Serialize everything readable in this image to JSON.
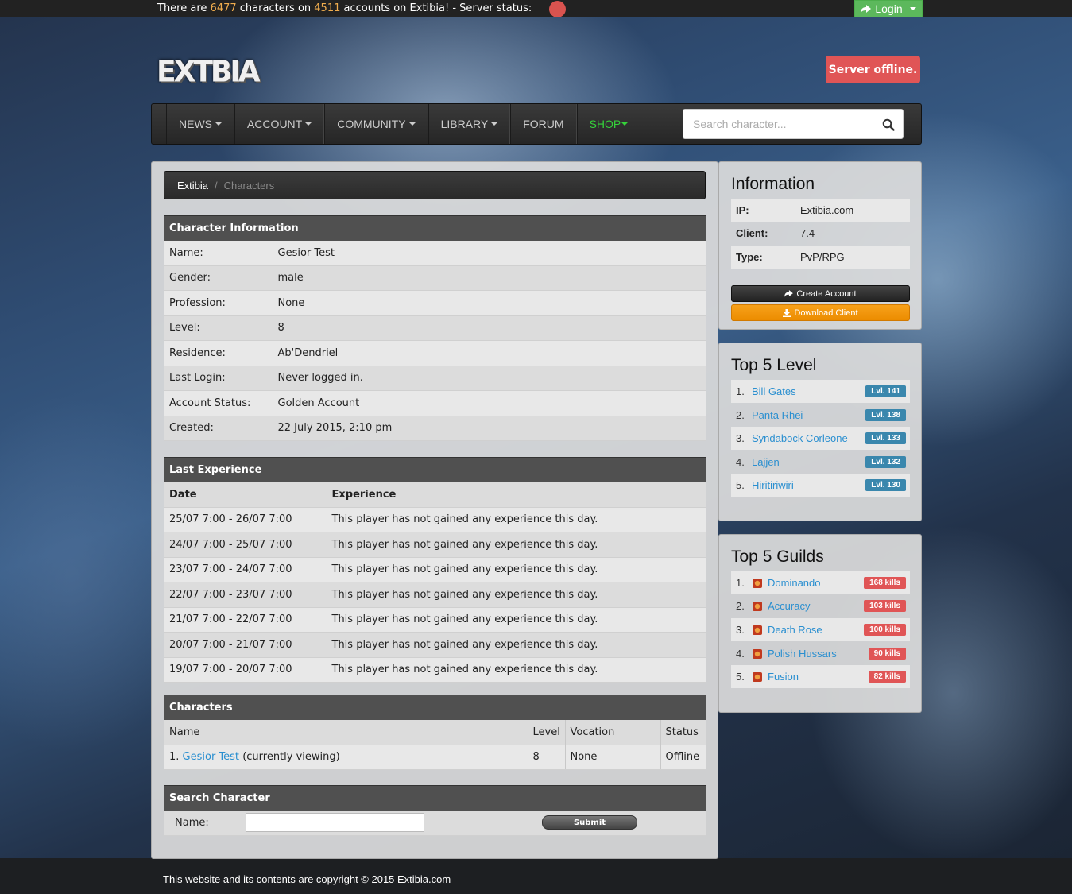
{
  "topbar": {
    "text_before": "There are",
    "characters_count": "6477",
    "text_mid1": "characters on",
    "accounts_count": "4511",
    "text_after": "accounts on Extibia! - Server status:",
    "login_label": "Login"
  },
  "logo_text": "EXTBIA",
  "server_status_label": "Server offline.",
  "nav": {
    "items": [
      {
        "label": "NEWS",
        "dropdown": true
      },
      {
        "label": "ACCOUNT",
        "dropdown": true
      },
      {
        "label": "COMMUNITY",
        "dropdown": true
      },
      {
        "label": "LIBRARY",
        "dropdown": true
      },
      {
        "label": "FORUM",
        "dropdown": false
      },
      {
        "label": "SHOP",
        "dropdown": true
      }
    ],
    "search_placeholder": "Search character..."
  },
  "breadcrumb": {
    "root": "Extibia",
    "sep": "/",
    "current": "Characters"
  },
  "character_info": {
    "title": "Character Information",
    "rows": [
      {
        "label": "Name:",
        "value": "Gesior Test"
      },
      {
        "label": "Gender:",
        "value": "male"
      },
      {
        "label": "Profession:",
        "value": "None"
      },
      {
        "label": "Level:",
        "value": "8"
      },
      {
        "label": "Residence:",
        "value": "Ab'Dendriel"
      },
      {
        "label": "Last Login:",
        "value": "Never logged in."
      },
      {
        "label": "Account Status:",
        "value": "Golden Account"
      },
      {
        "label": "Created:",
        "value": "22 July 2015, 2:10 pm"
      }
    ]
  },
  "last_experience": {
    "title": "Last Experience",
    "col_date": "Date",
    "col_exp": "Experience",
    "rows": [
      {
        "date": "25/07 7:00 - 26/07 7:00",
        "exp": "This player has not gained any experience this day."
      },
      {
        "date": "24/07 7:00 - 25/07 7:00",
        "exp": "This player has not gained any experience this day."
      },
      {
        "date": "23/07 7:00 - 24/07 7:00",
        "exp": "This player has not gained any experience this day."
      },
      {
        "date": "22/07 7:00 - 23/07 7:00",
        "exp": "This player has not gained any experience this day."
      },
      {
        "date": "21/07 7:00 - 22/07 7:00",
        "exp": "This player has not gained any experience this day."
      },
      {
        "date": "20/07 7:00 - 21/07 7:00",
        "exp": "This player has not gained any experience this day."
      },
      {
        "date": "19/07 7:00 - 20/07 7:00",
        "exp": "This player has not gained any experience this day."
      }
    ]
  },
  "characters": {
    "title": "Characters",
    "col_name": "Name",
    "col_level": "Level",
    "col_vocation": "Vocation",
    "col_status": "Status",
    "row": {
      "index": "1.",
      "name": "Gesior Test",
      "note": "(currently viewing)",
      "level": "8",
      "vocation": "None",
      "status": "Offline"
    }
  },
  "search_character": {
    "title": "Search Character",
    "name_label": "Name:",
    "submit_label": "Submit"
  },
  "information": {
    "title": "Information",
    "rows": [
      {
        "key": "IP:",
        "value": "Extibia.com"
      },
      {
        "key": "Client:",
        "value": "7.4"
      },
      {
        "key": "Type:",
        "value": "PvP/RPG"
      }
    ],
    "create_account": "Create Account",
    "download_client": "Download Client"
  },
  "top_level": {
    "title": "Top 5 Level",
    "rows": [
      {
        "num": "1.",
        "name": "Bill Gates",
        "badge": "Lvl. 141"
      },
      {
        "num": "2.",
        "name": "Panta Rhei",
        "badge": "Lvl. 138"
      },
      {
        "num": "3.",
        "name": "Syndabock Corleone",
        "badge": "Lvl. 133"
      },
      {
        "num": "4.",
        "name": "Lajjen",
        "badge": "Lvl. 132"
      },
      {
        "num": "5.",
        "name": "Hiritiriwiri",
        "badge": "Lvl. 130"
      }
    ]
  },
  "top_guilds": {
    "title": "Top 5 Guilds",
    "rows": [
      {
        "num": "1.",
        "name": "Dominando",
        "badge": "168 kills"
      },
      {
        "num": "2.",
        "name": "Accuracy",
        "badge": "103 kills"
      },
      {
        "num": "3.",
        "name": "Death Rose",
        "badge": "100 kills"
      },
      {
        "num": "4.",
        "name": "Polish Hussars",
        "badge": "90 kills"
      },
      {
        "num": "5.",
        "name": "Fusion",
        "badge": "82 kills"
      }
    ]
  },
  "footer": "This website and its contents are copyright © 2015 Extibia.com",
  "colors": {
    "accent": "#2a8fd0",
    "offline": "#e05556",
    "login": "#5cb85c",
    "shop": "#35d23a",
    "download": "#f7a11a"
  }
}
